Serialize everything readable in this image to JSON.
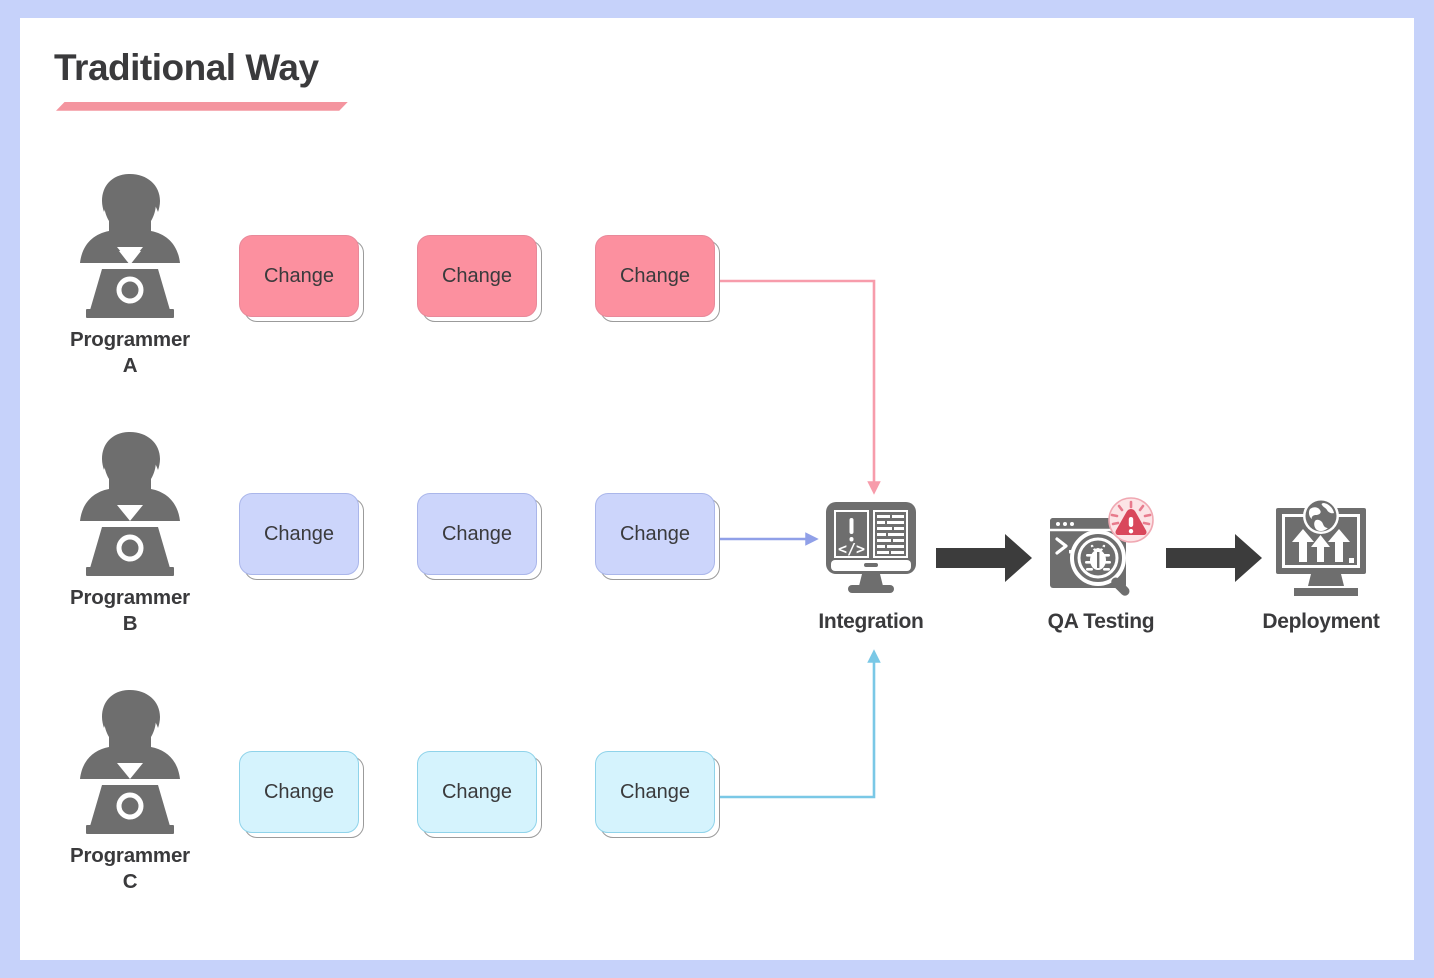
{
  "page": {
    "title": "Traditional Way",
    "background_color": "#c6d2fa",
    "card_color": "#ffffff",
    "accent_color": "#f4959f",
    "text_color": "#3a3a3c"
  },
  "programmers": [
    {
      "label": "Programmer\nA",
      "name": "Programmer A",
      "row_color": "#fc909f"
    },
    {
      "label": "Programmer\nB",
      "name": "Programmer B",
      "row_color": "#ccd5fb"
    },
    {
      "label": "Programmer\nC",
      "name": "Programmer C",
      "row_color": "#d5f3fd"
    }
  ],
  "changes": {
    "label": "Change",
    "row_a": [
      "Change",
      "Change",
      "Change"
    ],
    "row_b": [
      "Change",
      "Change",
      "Change"
    ],
    "row_c": [
      "Change",
      "Change",
      "Change"
    ]
  },
  "pipeline": [
    {
      "label": "Integration",
      "icon": "monitor-code-icon"
    },
    {
      "label": "QA Testing",
      "icon": "bug-magnifier-terminal-icon"
    },
    {
      "label": "Deployment",
      "icon": "monitor-arrows-globe-icon"
    }
  ],
  "connectors": [
    {
      "from": "Programmer A",
      "to": "Integration",
      "color": "#f79cab",
      "shape": "right-then-down"
    },
    {
      "from": "Programmer B",
      "to": "Integration",
      "color": "#90a0e8",
      "shape": "straight-right"
    },
    {
      "from": "Programmer C",
      "to": "Integration",
      "color": "#7ac8e6",
      "shape": "right-then-up"
    },
    {
      "from": "Integration",
      "to": "QA Testing",
      "color": "#3c3c3c",
      "shape": "straight-right"
    },
    {
      "from": "QA Testing",
      "to": "Deployment",
      "color": "#3c3c3c",
      "shape": "straight-right"
    }
  ],
  "badge": {
    "name": "warning-badge",
    "circle_fill": "#fce4e6",
    "circle_stroke": "#f0a8b2",
    "triangle_fill": "#d9475b"
  }
}
